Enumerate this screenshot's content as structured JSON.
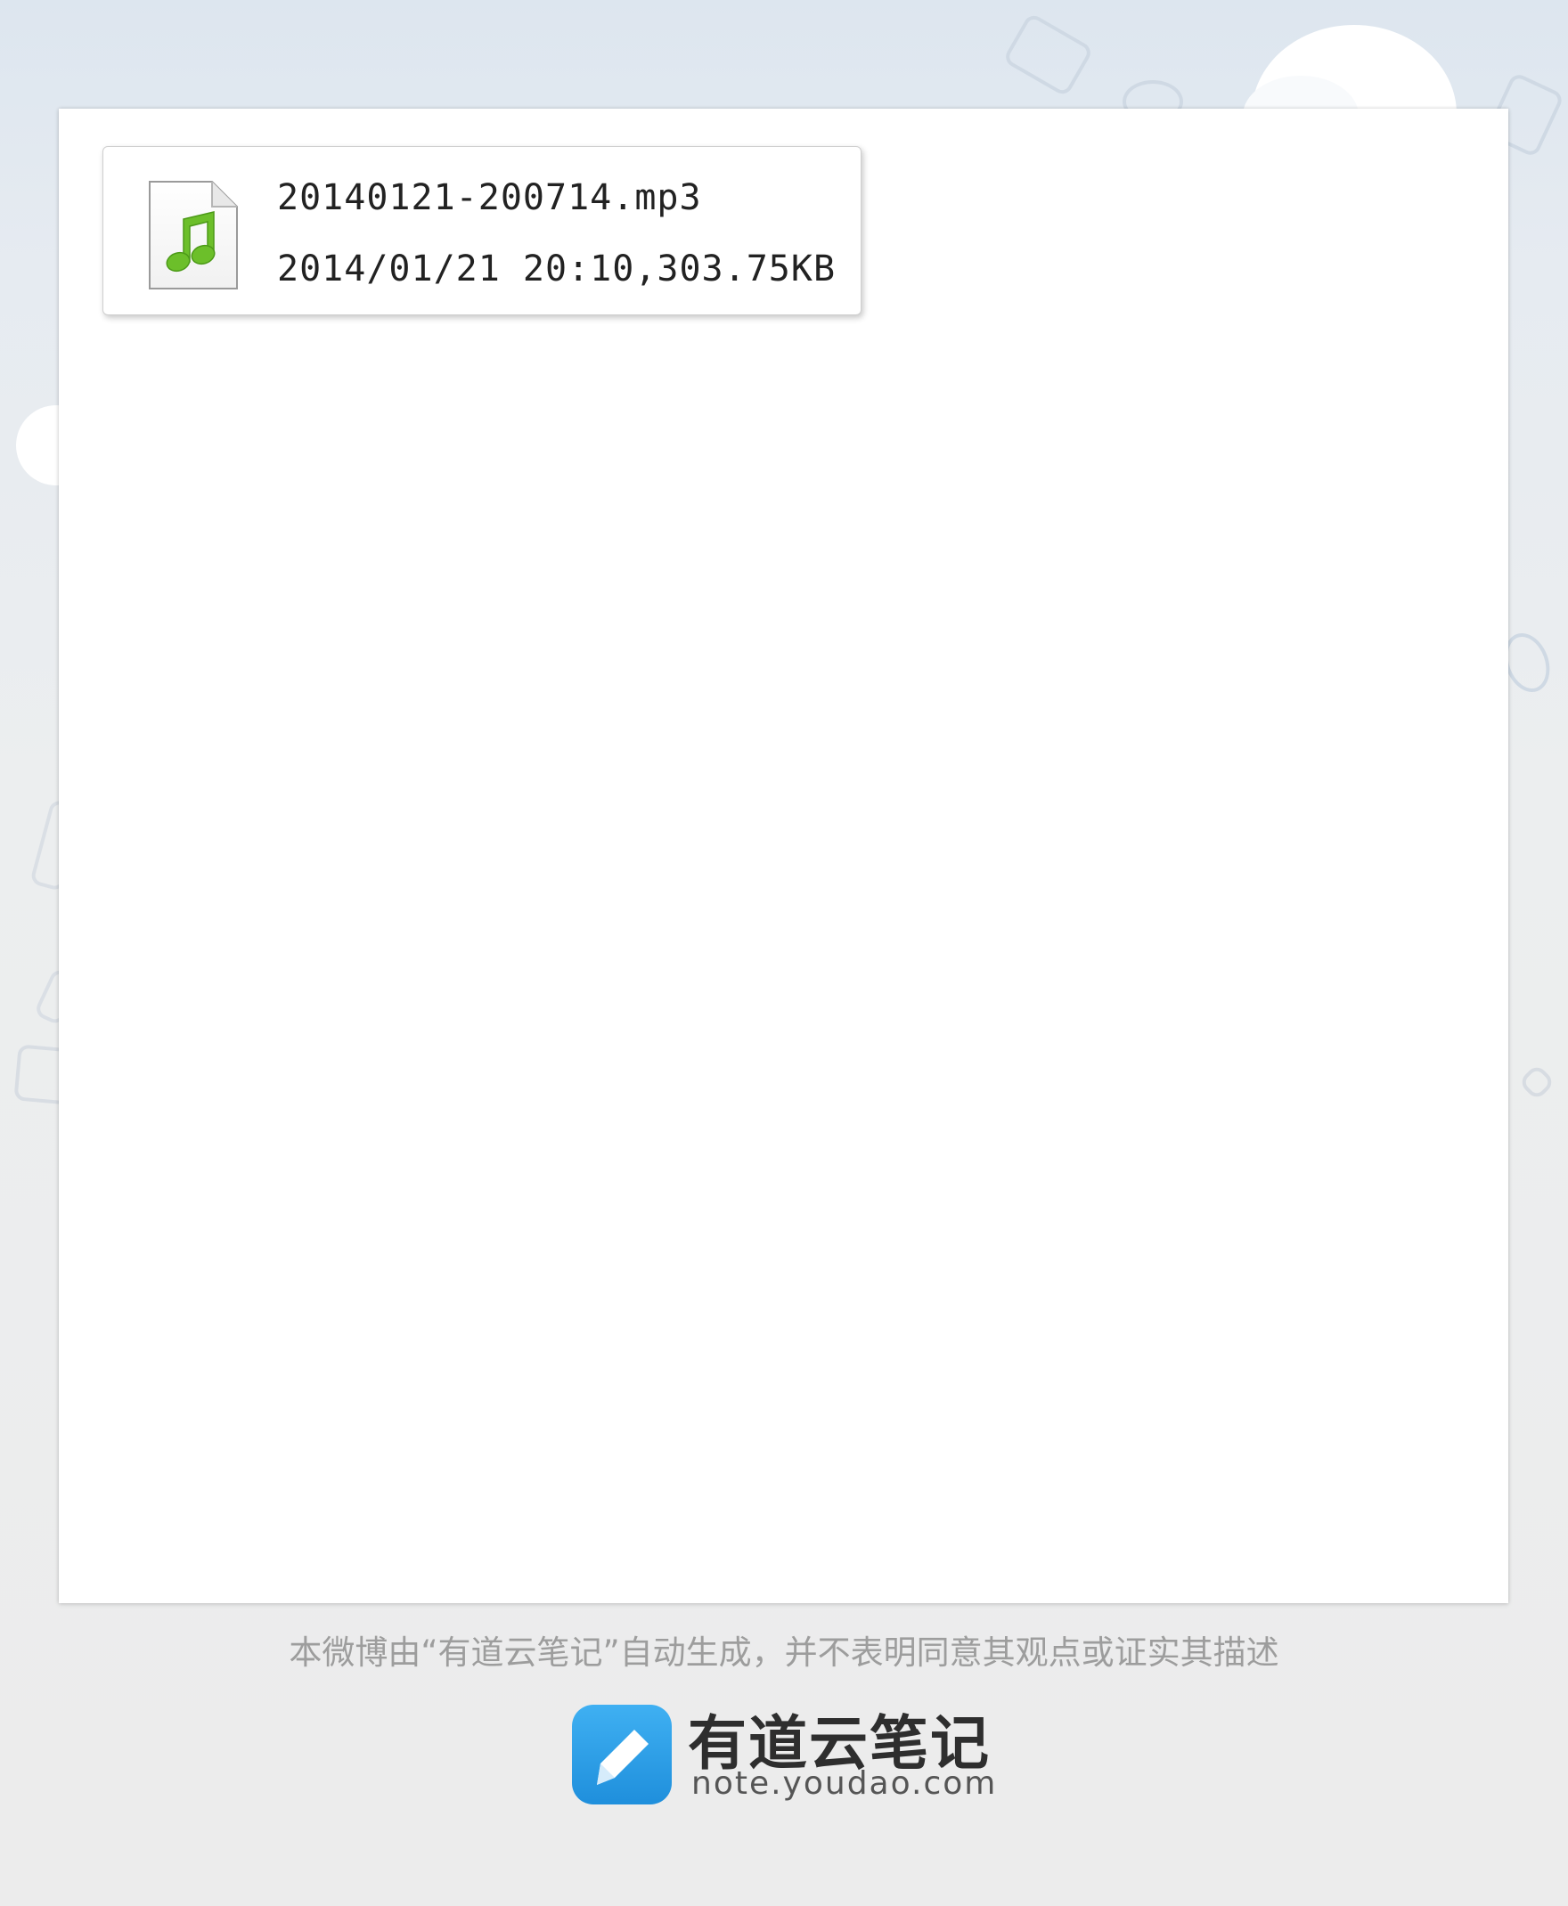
{
  "attachment": {
    "icon": "music-file-icon",
    "file_name": "20140121-200714.mp3",
    "meta": "2014/01/21  20:10,303.75KB"
  },
  "footer": {
    "disclaimer": "本微博由“有道云笔记”自动生成，并不表明同意其观点或证实其描述",
    "brand_name": "有道云笔记",
    "brand_url": "note.youdao.com",
    "brand_logo_icon": "pencil-note-icon"
  },
  "colors": {
    "brand_blue": "#2a9ee9",
    "music_green": "#6cbf2a"
  }
}
